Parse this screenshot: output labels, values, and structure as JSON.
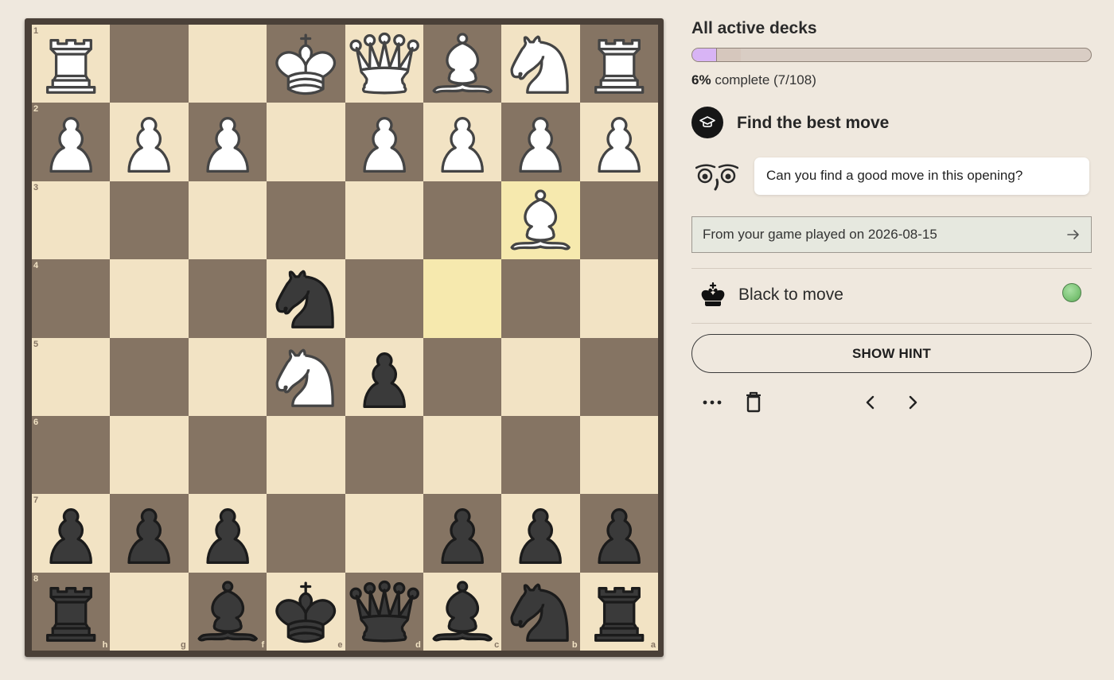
{
  "board": {
    "files": [
      "h",
      "g",
      "f",
      "e",
      "d",
      "c",
      "b",
      "a"
    ],
    "ranks": [
      "1",
      "2",
      "3",
      "4",
      "5",
      "6",
      "7",
      "8"
    ],
    "highlighted_squares": [
      "c4",
      "b3"
    ],
    "pieces": [
      {
        "square": "h1",
        "color": "white",
        "type": "rook"
      },
      {
        "square": "e1",
        "color": "white",
        "type": "king"
      },
      {
        "square": "d1",
        "color": "white",
        "type": "queen"
      },
      {
        "square": "c1",
        "color": "white",
        "type": "bishop"
      },
      {
        "square": "b1",
        "color": "white",
        "type": "knight"
      },
      {
        "square": "a1",
        "color": "white",
        "type": "rook"
      },
      {
        "square": "h2",
        "color": "white",
        "type": "pawn"
      },
      {
        "square": "g2",
        "color": "white",
        "type": "pawn"
      },
      {
        "square": "f2",
        "color": "white",
        "type": "pawn"
      },
      {
        "square": "d2",
        "color": "white",
        "type": "pawn"
      },
      {
        "square": "c2",
        "color": "white",
        "type": "pawn"
      },
      {
        "square": "b2",
        "color": "white",
        "type": "pawn"
      },
      {
        "square": "a2",
        "color": "white",
        "type": "pawn"
      },
      {
        "square": "b3",
        "color": "white",
        "type": "bishop"
      },
      {
        "square": "e4",
        "color": "black",
        "type": "knight"
      },
      {
        "square": "e5",
        "color": "white",
        "type": "knight"
      },
      {
        "square": "d5",
        "color": "black",
        "type": "pawn"
      },
      {
        "square": "h7",
        "color": "black",
        "type": "pawn"
      },
      {
        "square": "g7",
        "color": "black",
        "type": "pawn"
      },
      {
        "square": "f7",
        "color": "black",
        "type": "pawn"
      },
      {
        "square": "c7",
        "color": "black",
        "type": "pawn"
      },
      {
        "square": "b7",
        "color": "black",
        "type": "pawn"
      },
      {
        "square": "a7",
        "color": "black",
        "type": "pawn"
      },
      {
        "square": "h8",
        "color": "black",
        "type": "rook"
      },
      {
        "square": "f8",
        "color": "black",
        "type": "bishop"
      },
      {
        "square": "e8",
        "color": "black",
        "type": "king"
      },
      {
        "square": "d8",
        "color": "black",
        "type": "queen"
      },
      {
        "square": "c8",
        "color": "black",
        "type": "bishop"
      },
      {
        "square": "b8",
        "color": "black",
        "type": "knight"
      },
      {
        "square": "a8",
        "color": "black",
        "type": "rook"
      }
    ]
  },
  "deck": {
    "title": "All active decks",
    "progress_fraction": 0.06,
    "progress_secondary_fraction": 0.12,
    "percent_label": "6%",
    "complete_label": "complete (7/108)"
  },
  "task": {
    "icon": "graduation-cap-icon",
    "title": "Find the best move"
  },
  "coach": {
    "icon": "owl-eyes-icon",
    "message": "Can you find a good move in this opening?"
  },
  "game_link": {
    "text": "From your game played on 2026-08-15",
    "icon": "arrow-right-icon"
  },
  "turn": {
    "icon": "black-king-icon",
    "text": "Black to move",
    "status_color": "#7cc476"
  },
  "hint_button": {
    "label": "SHOW HINT"
  },
  "toolbar": {
    "icons": [
      "more-icon",
      "trash-icon",
      "chevron-left-icon",
      "chevron-right-icon"
    ]
  },
  "colors": {
    "light_square": "#f2e3c4",
    "dark_square": "#857463",
    "highlight": "#f6e9ae",
    "progress_fill": "#d8b4f5",
    "background": "#efe8de"
  }
}
